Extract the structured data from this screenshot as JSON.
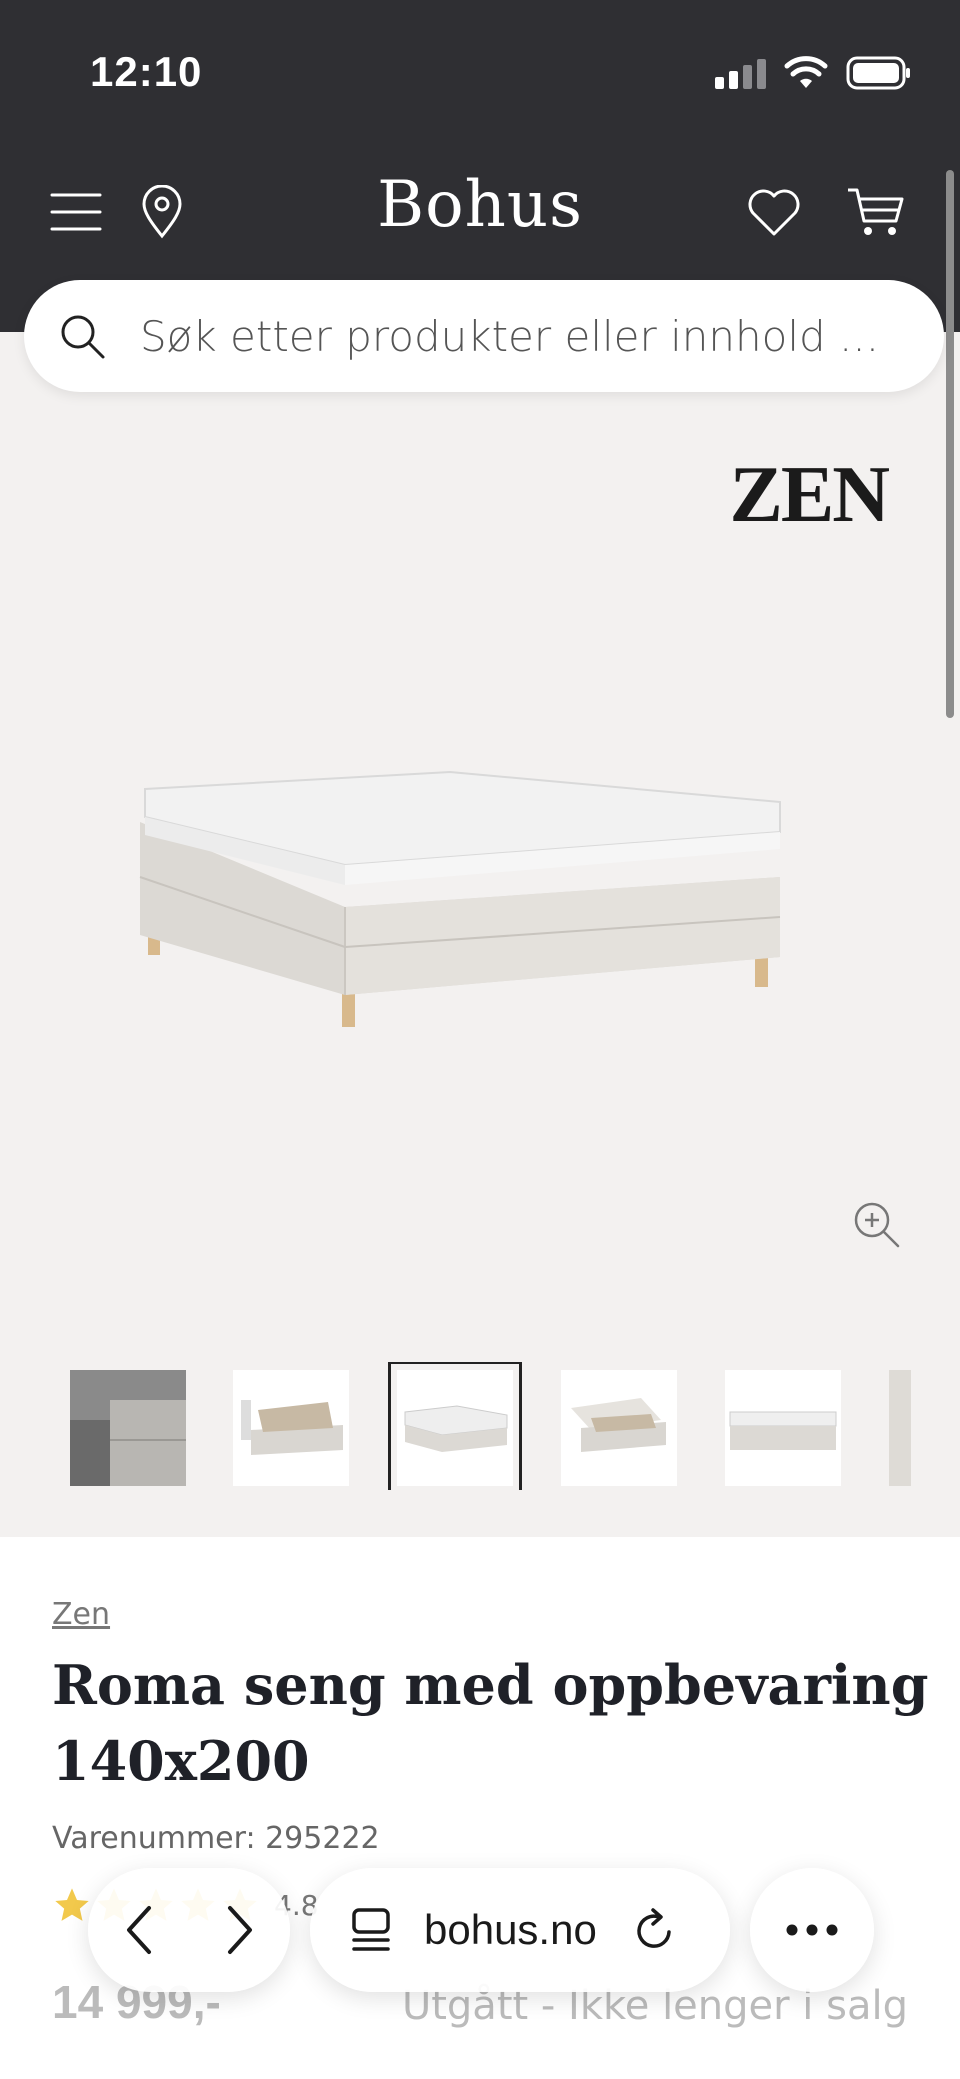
{
  "status": {
    "time": "12:10"
  },
  "header": {
    "logo": "Bohus"
  },
  "search": {
    "placeholder": "Søk etter produkter eller innhold ..."
  },
  "gallery": {
    "brand_mark": "ZEN",
    "thumbnails": [
      "Seng detalj",
      "Seng med oppbevaring åpen",
      "Seng front",
      "Seng oppbevaring",
      "Seng side",
      "Stoff"
    ],
    "active_thumbnail": 2
  },
  "product": {
    "brand": "Zen",
    "title": "Roma seng med oppbevaring 140x200",
    "sku": "Varenummer: 295222",
    "rating_value": "4.8",
    "rating_stars": 5,
    "price": "14 999,-",
    "availability": "Utgått - Ikke lenger i salg"
  },
  "browser": {
    "url": "bohus.no"
  },
  "colors": {
    "header_bg": "#2f2f33",
    "page_bg": "#f3f1f0",
    "star": "#f2c94c"
  }
}
